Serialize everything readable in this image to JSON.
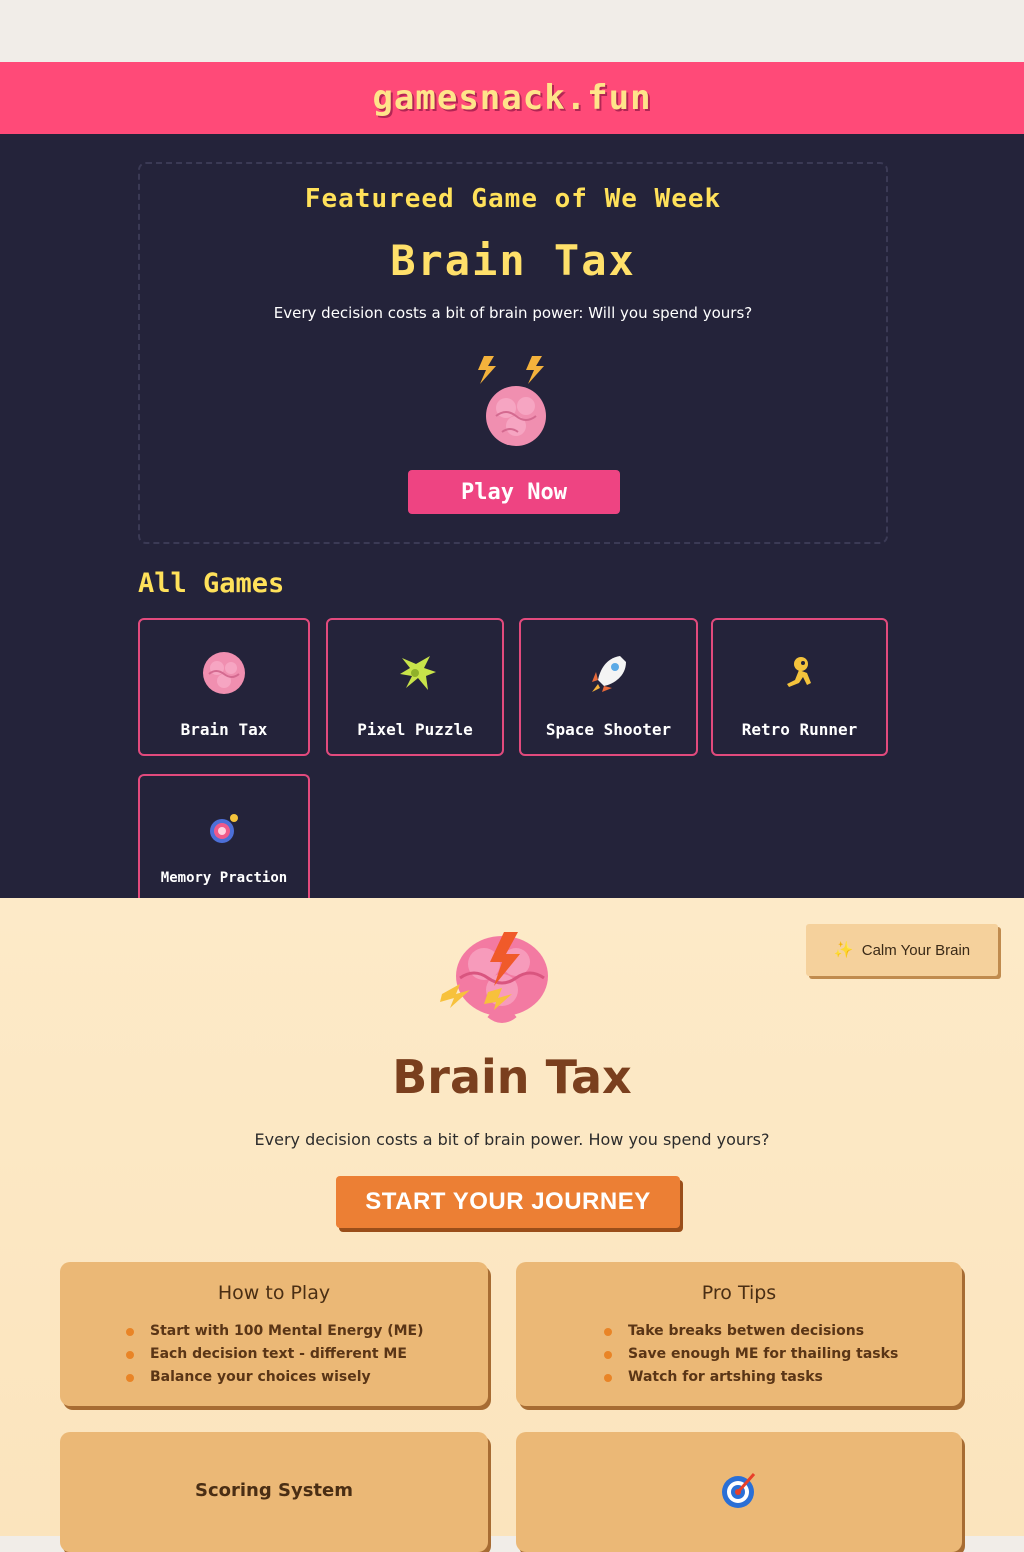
{
  "site": {
    "title": "gamesnack.fun"
  },
  "featured": {
    "label": "Featureed Game of We Week",
    "title": "Brain Tax",
    "description": "Every decision costs a bit of brain power: Will you spend yours?",
    "play_label": "Play Now"
  },
  "all_games": {
    "title": "All Games",
    "games": [
      {
        "label": "Brain Tax",
        "icon": "brain-icon"
      },
      {
        "label": "Pixel Puzzle",
        "icon": "puzzle-icon"
      },
      {
        "label": "Space Shooter",
        "icon": "rocket-icon"
      },
      {
        "label": "Retro Runner",
        "icon": "runner-icon"
      },
      {
        "label": "Memory Praction",
        "icon": "memory-orb-icon"
      }
    ]
  },
  "game_page": {
    "calm_label": "Calm Your Brain",
    "title": "Brain Tax",
    "description": "Every decision costs a bit of brain power. How you spend yours?",
    "cta_label": "START YOUR JOURNEY",
    "how_to_play": {
      "title": "How to Play",
      "items": [
        "Start with 100 Mental Energy (ME)",
        "Each decision text - different ME",
        "Balance your choices wisely"
      ]
    },
    "pro_tips": {
      "title": "Pro Tips",
      "items": [
        "Take breaks betwen decisions",
        "Save enough ME for thailing tasks",
        "Watch for artshing tasks"
      ]
    },
    "scoring": {
      "title": "Scoring System"
    }
  },
  "colors": {
    "header_bg": "#ff4a78",
    "dark_bg": "#24233a",
    "accent_yellow": "#ffe15a",
    "card_border": "#e24a7d",
    "cta_orange": "#ec7f34",
    "panel_bg": "#ebb876"
  }
}
